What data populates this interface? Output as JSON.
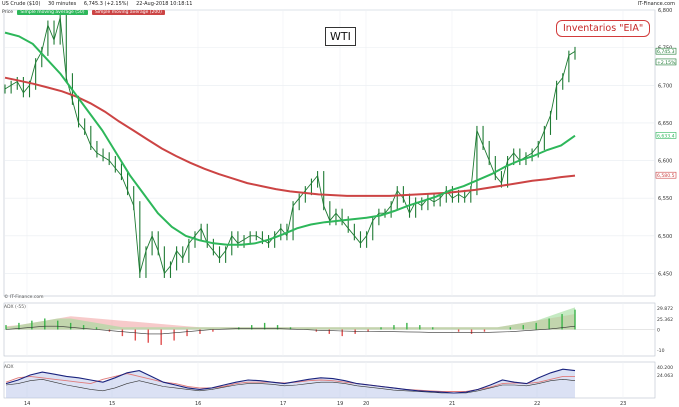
{
  "header": {
    "instrument": "US Crude ($10)",
    "interval": "30 minutes",
    "last_price": "6,745.3 (+2.15%)",
    "timestamp": "22-Aug-2018 10:18:11",
    "source": "IT-Finance.com"
  },
  "price_panel": {
    "title": "Price",
    "legend_green": "Simple moving average (50)",
    "legend_red": "Simple moving average (200)",
    "watermark": "© IT-Finance.com"
  },
  "annotations": {
    "wti": "WTI",
    "eia": "Inventarios \"EIA\""
  },
  "colors": {
    "price_line": "#1e7a33",
    "ma_short": "#2db75a",
    "ma_long": "#cc4444",
    "adx": "#1a237e",
    "positive": "#3cb44b",
    "negative": "#e05050"
  },
  "chart_data": [
    {
      "type": "line",
      "title": "",
      "ylim": [
        6420,
        6800
      ],
      "x_ticks": [
        "14",
        "15",
        "16",
        "17",
        "19",
        "20",
        "21",
        "22",
        "23"
      ],
      "y_ticks": [
        "6,450",
        "6,500",
        "6,550",
        "6,600",
        "6,650",
        "6,700",
        "6,750",
        "6,800"
      ],
      "price_labels": [
        {
          "text": "6,745.3",
          "value": 6745.3,
          "color": "#1e7a33"
        },
        {
          "text": "+2.15%",
          "value": 6731,
          "color": "#1e7a33"
        },
        {
          "text": "6,633.4",
          "value": 6633.4,
          "color": "#2db75a"
        },
        {
          "text": "6,580.5",
          "value": 6580.5,
          "color": "#cc4444"
        }
      ],
      "series": [
        {
          "name": "US Crude ($10)",
          "values": [
            6695,
            6700,
            6705,
            6690,
            6700,
            6730,
            6745,
            6780,
            6760,
            6790,
            6710,
            6680,
            6650,
            6640,
            6620,
            6610,
            6605,
            6600,
            6590,
            6580,
            6560,
            6540,
            6450,
            6480,
            6500,
            6480,
            6450,
            6460,
            6480,
            6470,
            6490,
            6500,
            6510,
            6490,
            6480,
            6470,
            6480,
            6500,
            6490,
            6495,
            6500,
            6500,
            6495,
            6490,
            6500,
            6510,
            6500,
            6540,
            6550,
            6560,
            6570,
            6580,
            6540,
            6520,
            6530,
            6520,
            6510,
            6500,
            6490,
            6500,
            6520,
            6530,
            6530,
            6540,
            6560,
            6550,
            6530,
            6545,
            6540,
            6550,
            6545,
            6550,
            6560,
            6550,
            6555,
            6550,
            6560,
            6640,
            6620,
            6600,
            6580,
            6570,
            6600,
            6610,
            6600,
            6605,
            6610,
            6620,
            6640,
            6660,
            6700,
            6710,
            6740,
            6745
          ]
        },
        {
          "name": "Simple moving average (50)",
          "values": [
            6770,
            6765,
            6755,
            6735,
            6715,
            6690,
            6665,
            6640,
            6610,
            6580,
            6555,
            6530,
            6512,
            6500,
            6494,
            6490,
            6488,
            6488,
            6490,
            6495,
            6502,
            6510,
            6515,
            6518,
            6520,
            6522,
            6524,
            6527,
            6533,
            6540,
            6546,
            6552,
            6560,
            6566,
            6574,
            6582,
            6592,
            6600,
            6606,
            6614,
            6620,
            6633
          ]
        },
        {
          "name": "Simple moving average (200)",
          "values": [
            6710,
            6706,
            6702,
            6697,
            6692,
            6685,
            6676,
            6665,
            6652,
            6640,
            6628,
            6616,
            6606,
            6597,
            6589,
            6582,
            6576,
            6570,
            6566,
            6562,
            6559,
            6557,
            6555,
            6554,
            6553,
            6553,
            6553,
            6553,
            6554,
            6555,
            6556,
            6557,
            6559,
            6561,
            6564,
            6567,
            6570,
            6573,
            6575,
            6578,
            6580
          ]
        }
      ]
    },
    {
      "type": "bar",
      "title": "ADX (-55)",
      "value_labels": [
        "29.872",
        "25.362",
        "0",
        "-10"
      ],
      "ylim": [
        -12,
        12
      ],
      "series": [
        {
          "name": "histogram",
          "values": [
            2,
            3,
            4,
            5,
            4,
            3,
            2,
            1,
            -1,
            -3,
            -5,
            -6,
            -7,
            -5,
            -3,
            -2,
            -1,
            0,
            1,
            2,
            3,
            2,
            1,
            0,
            -1,
            -2,
            -3,
            -2,
            -1,
            1,
            2,
            3,
            2,
            1,
            0,
            -1,
            -2,
            -1,
            0,
            1,
            2,
            3,
            5,
            7,
            9
          ]
        },
        {
          "name": "red band",
          "values": [
            1.5,
            2,
            3,
            4,
            5,
            6,
            5.5,
            5,
            4.5,
            4,
            3.5,
            3,
            2.5,
            2,
            1.5,
            1,
            1,
            1,
            1,
            1,
            1,
            1,
            1,
            1,
            1,
            1,
            1,
            1,
            1,
            1,
            1,
            1,
            1,
            1,
            1,
            1,
            1,
            1,
            1,
            2,
            3,
            4,
            5,
            6,
            7
          ]
        },
        {
          "name": "green band",
          "values": [
            1,
            2,
            3,
            4,
            5,
            5,
            4,
            3,
            2,
            1,
            1,
            1,
            1,
            1,
            1,
            1,
            1,
            1,
            1,
            1,
            1,
            1,
            1,
            1,
            1,
            1,
            1,
            1,
            1,
            1,
            1,
            1,
            1,
            1,
            1,
            1,
            1,
            1,
            1,
            2,
            3,
            4,
            6,
            8,
            10
          ]
        },
        {
          "name": "baseline",
          "values": [
            0,
            0.5,
            1,
            1.5,
            1.5,
            1,
            0.5,
            0,
            -0.5,
            -1,
            -1.5,
            -2,
            -2,
            -1.5,
            -1,
            -0.5,
            0,
            0.2,
            0.4,
            0.5,
            0.5,
            0.4,
            0.2,
            0,
            -0.3,
            -0.5,
            -0.7,
            -0.8,
            -0.9,
            -1,
            -1,
            -1.1,
            -1.2,
            -1.3,
            -1.3,
            -1.4,
            -1.4,
            -1.3,
            -1.2,
            -1,
            -0.6,
            -0.2,
            0.2,
            0.8,
            1.5
          ]
        }
      ]
    },
    {
      "type": "area",
      "title": "ADX",
      "value_labels": [
        "40.200",
        "24.063"
      ],
      "ylim": [
        0,
        50
      ],
      "series": [
        {
          "name": "ADX",
          "values": [
            20,
            25,
            32,
            36,
            33,
            30,
            28,
            25,
            22,
            28,
            35,
            38,
            30,
            22,
            18,
            14,
            12,
            14,
            18,
            22,
            25,
            24,
            22,
            20,
            23,
            26,
            28,
            27,
            24,
            20,
            18,
            16,
            14,
            12,
            10,
            9,
            8,
            7,
            8,
            12,
            18,
            25,
            22,
            20,
            28,
            35,
            40,
            38
          ]
        },
        {
          "name": "DI+",
          "values": [
            18,
            20,
            24,
            26,
            22,
            18,
            15,
            12,
            10,
            14,
            20,
            24,
            20,
            16,
            14,
            12,
            10,
            12,
            15,
            18,
            20,
            20,
            19,
            17,
            18,
            20,
            22,
            22,
            20,
            17,
            15,
            13,
            11,
            10,
            9,
            8,
            7,
            7,
            7,
            10,
            14,
            18,
            18,
            17,
            20,
            24,
            26,
            24
          ]
        },
        {
          "name": "DI-",
          "values": [
            22,
            28,
            30,
            28,
            26,
            24,
            22,
            20,
            26,
            30,
            34,
            30,
            26,
            22,
            20,
            16,
            14,
            14,
            16,
            20,
            22,
            22,
            22,
            21,
            22,
            24,
            25,
            24,
            22,
            20,
            18,
            16,
            14,
            12,
            11,
            10,
            9,
            9,
            9,
            12,
            15,
            20,
            21,
            20,
            22,
            26,
            30,
            30
          ]
        }
      ]
    }
  ]
}
